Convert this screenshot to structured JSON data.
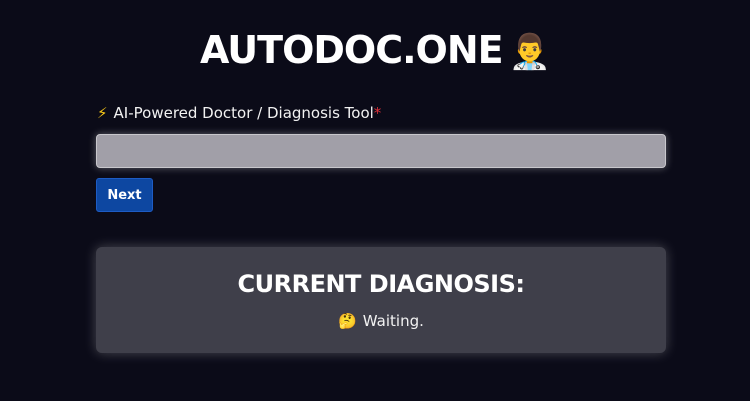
{
  "header": {
    "title": "AUTODOC.ONE",
    "title_emoji": "👨‍⚕️"
  },
  "form": {
    "label_icon": "⚡",
    "label": "AI-Powered Doctor / Diagnosis Tool",
    "required_marker": "*",
    "input_value": "",
    "next_label": "Next"
  },
  "diagnosis": {
    "title": "CURRENT DIAGNOSIS:",
    "status_emoji": "🤔",
    "status": "Waiting."
  }
}
